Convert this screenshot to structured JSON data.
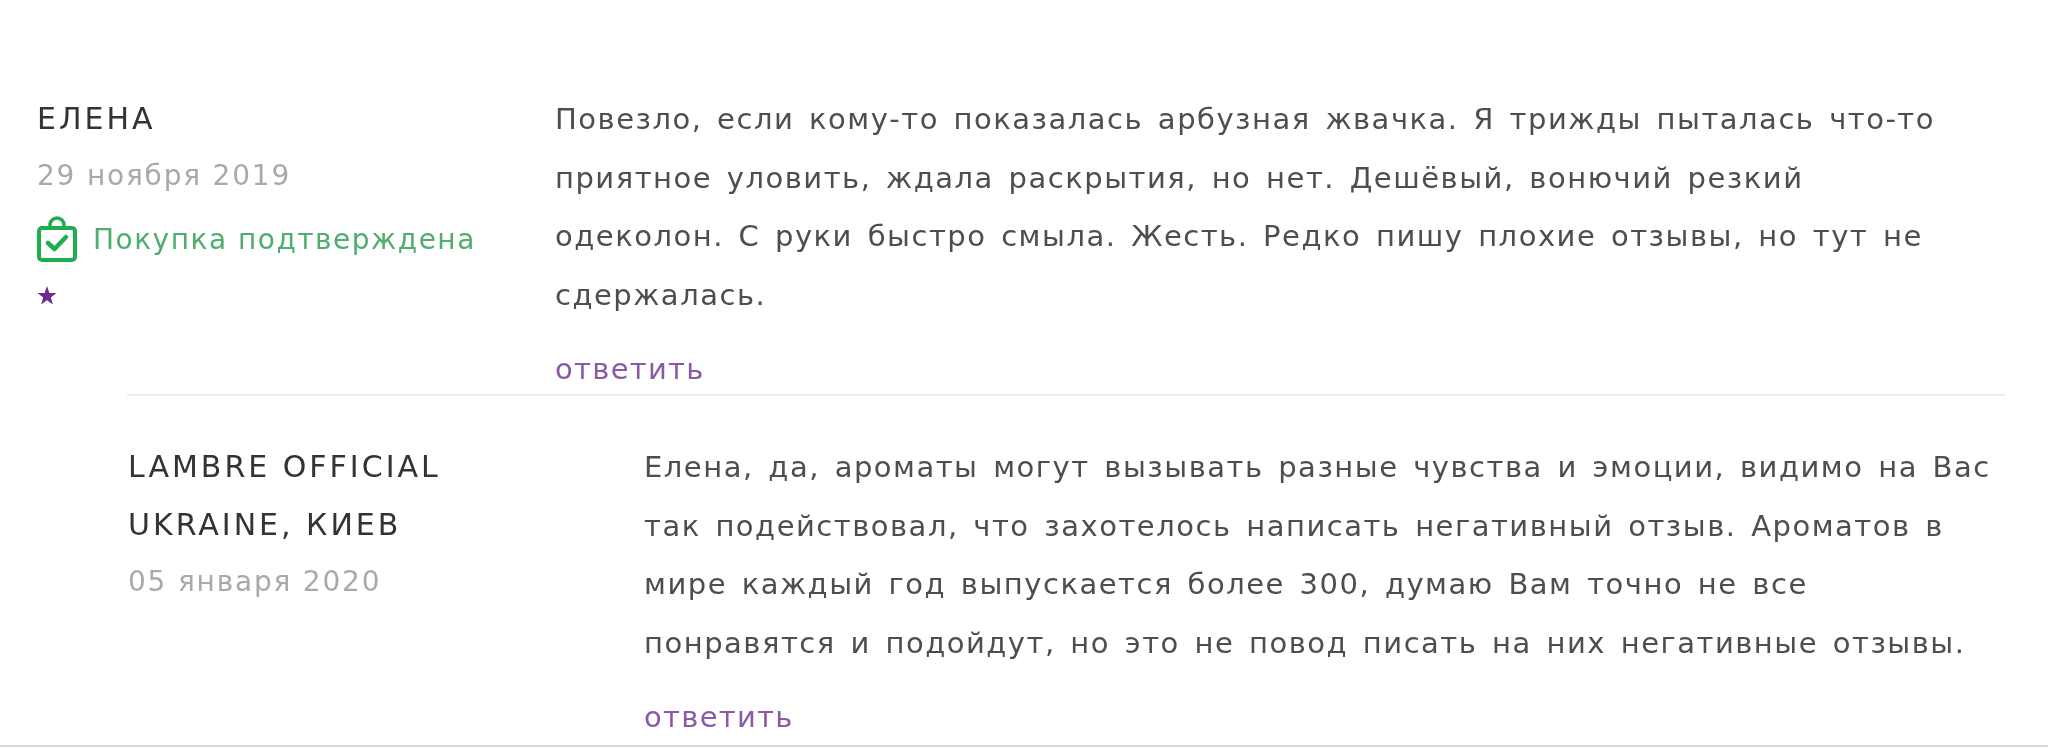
{
  "reviews": [
    {
      "author": "ЕЛЕНА",
      "date": "29 ноября 2019",
      "verified": true,
      "verified_label": "Покупка подтверждена",
      "text": "Повезло, если кому-то показалась арбузная жвачка. Я трижды пыталась что-то приятное уловить, ждала раскрытия, но нет. Дешёвый, вонючий резкий одеколон. С руки быстро смыла. Жесть. Редко пишу плохие отзывы, но тут не сдержалась.",
      "reply_link": "ответить",
      "replies": [
        {
          "author": "LAMBRE OFFICIAL UKRAINE, КИЕВ",
          "date": "05 января 2020",
          "text": "Елена, да, ароматы могут вызывать разные чувства и эмоции, видимо на Вас так подействовал, что захотелось написать негативный отзыв. Ароматов в мире каждый год выпускается более 300, думаю Вам точно не все понравятся и подойдут, но это не повод писать на них негативные отзывы.",
          "reply_link": "ответить"
        }
      ]
    }
  ]
}
